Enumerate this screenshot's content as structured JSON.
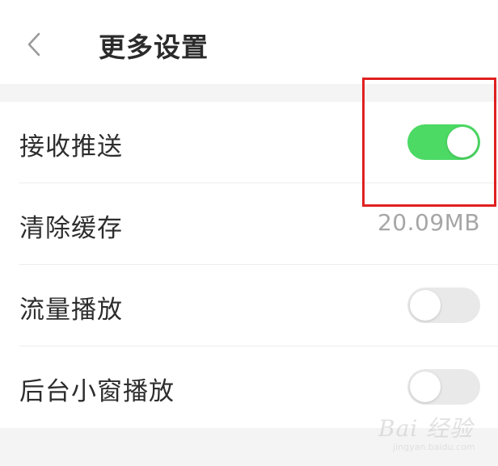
{
  "header": {
    "title": "更多设置",
    "back_icon": "chevron-left-icon"
  },
  "settings": {
    "items": [
      {
        "label": "接收推送",
        "control": "toggle",
        "state": "on"
      },
      {
        "label": "清除缓存",
        "control": "value",
        "value": "20.09MB"
      },
      {
        "label": "流量播放",
        "control": "toggle",
        "state": "off"
      },
      {
        "label": "后台小窗播放",
        "control": "toggle",
        "state": "off"
      }
    ]
  },
  "colors": {
    "toggle_on": "#4cd964",
    "toggle_off": "#e9e9e9",
    "highlight": "#e02020",
    "value_text": "#a6a6a6"
  },
  "watermark": {
    "text": "Bai 经验",
    "sub": "jingyan.baidu.com"
  }
}
